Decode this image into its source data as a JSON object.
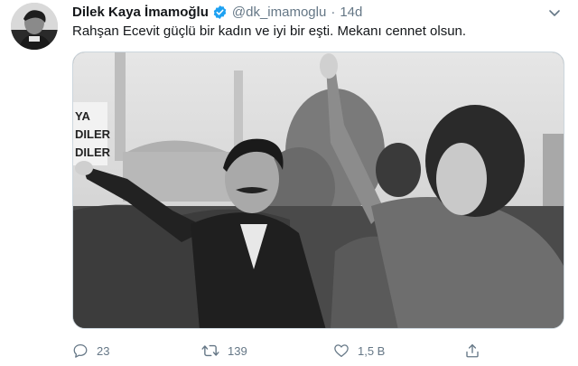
{
  "tweet": {
    "author": {
      "display_name": "Dilek Kaya İmamoğlu",
      "handle": "@dk_imamoglu",
      "verified": true,
      "avatar_icon": "profile-photo"
    },
    "separator": "·",
    "time": "14d",
    "text": "Rahşan Ecevit güçlü bir kadın ve iyi bir eşti. Mekanı cennet olsun.",
    "media": {
      "type": "black-and-white photo",
      "sign_text": [
        "YA",
        "DILER",
        "DILER"
      ]
    },
    "actions": {
      "reply_count": "23",
      "retweet_count": "139",
      "like_count": "1,5 B"
    }
  },
  "icons": {
    "verified": "verified-badge-icon",
    "caret": "chevron-down-icon",
    "reply": "reply-icon",
    "retweet": "retweet-icon",
    "like": "heart-icon",
    "share": "share-icon"
  },
  "colors": {
    "primary_text": "#14171a",
    "secondary_text": "#657786",
    "verified_blue": "#1da1f2"
  }
}
